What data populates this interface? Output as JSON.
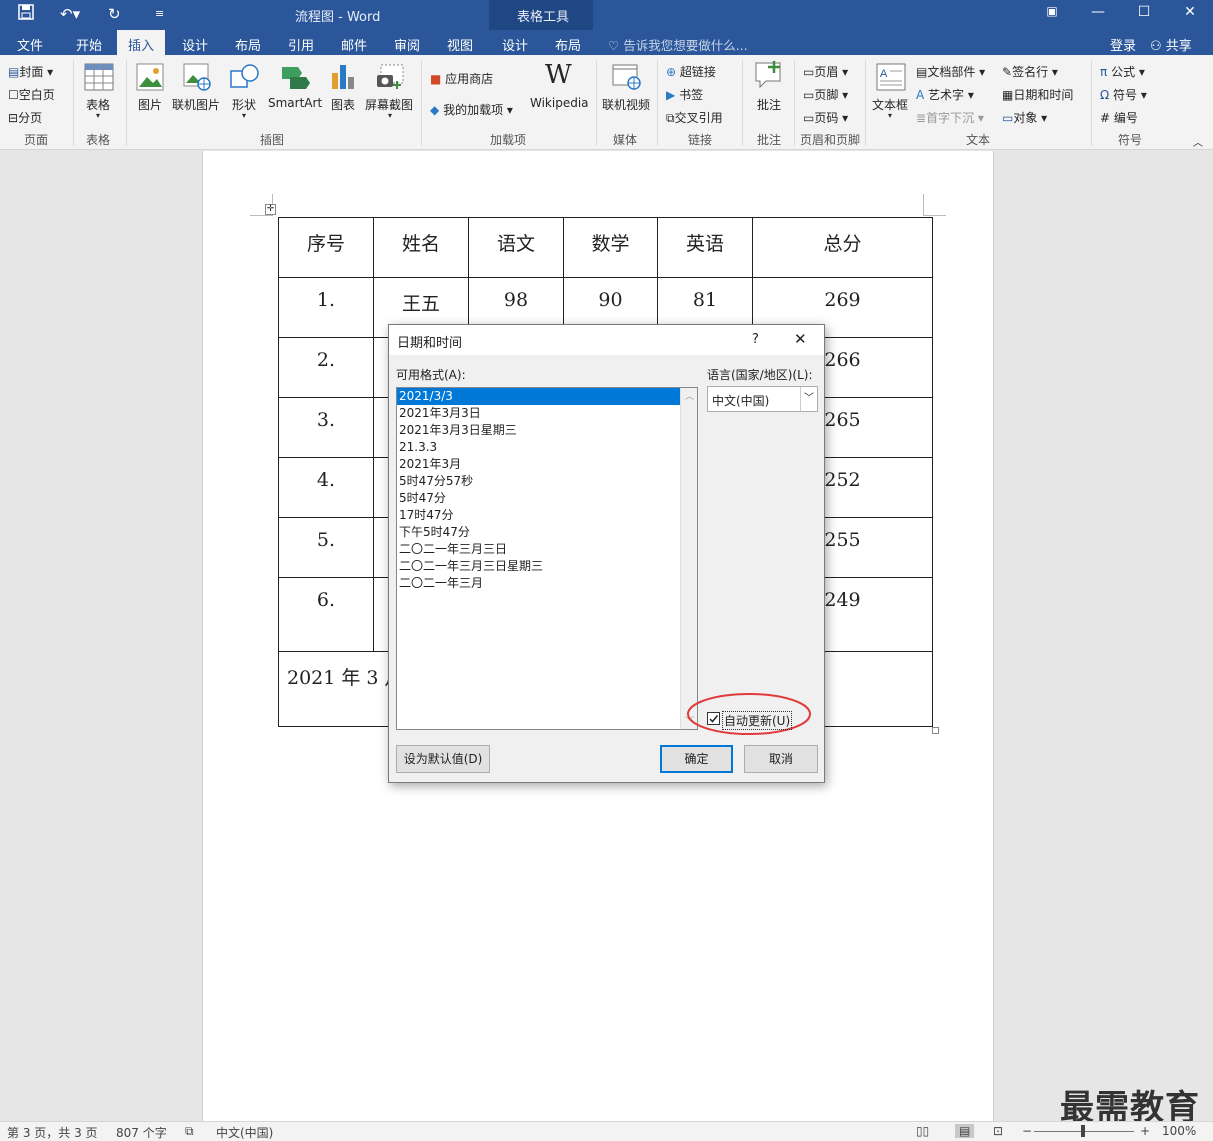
{
  "titlebar": {
    "doc_title": "流程图 - Word",
    "context_title": "表格工具"
  },
  "tabs": [
    "文件",
    "开始",
    "插入",
    "设计",
    "布局",
    "引用",
    "邮件",
    "审阅",
    "视图",
    "设计",
    "布局"
  ],
  "tell_me": "告诉我您想要做什么...",
  "account": {
    "login": "登录",
    "share": "共享"
  },
  "ribbon": {
    "pages": {
      "cover": "封面",
      "blank": "空白页",
      "break": "分页",
      "group": "页面"
    },
    "tables": {
      "table": "表格",
      "group": "表格"
    },
    "illustrations": {
      "picture": "图片",
      "online_picture": "联机图片",
      "shapes": "形状",
      "smartart": "SmartArt",
      "chart": "图表",
      "screenshot": "屏幕截图",
      "group": "插图"
    },
    "addins": {
      "store": "应用商店",
      "my_addins": "我的加载项",
      "wikipedia": "Wikipedia",
      "group": "加载项"
    },
    "media": {
      "online_video": "联机视频",
      "group": "媒体"
    },
    "links": {
      "hyperlink": "超链接",
      "bookmark": "书签",
      "crossref": "交叉引用",
      "group": "链接"
    },
    "comments": {
      "comment": "批注",
      "group": "批注"
    },
    "header_footer": {
      "header": "页眉",
      "footer": "页脚",
      "page_number": "页码",
      "group": "页眉和页脚"
    },
    "text": {
      "textbox": "文本框",
      "quickparts": "文档部件",
      "wordart": "艺术字",
      "dropcap": "首字下沉",
      "signature": "签名行",
      "datetime": "日期和时间",
      "object": "对象",
      "group": "文本"
    },
    "symbols": {
      "equation": "公式",
      "symbol": "符号",
      "number": "编号",
      "group": "符号"
    }
  },
  "table": {
    "headers": [
      "序号",
      "姓名",
      "语文",
      "数学",
      "英语",
      "总分"
    ],
    "rows": [
      [
        "1.",
        "王五",
        "98",
        "90",
        "81",
        "269"
      ],
      [
        "2.",
        "",
        "",
        "",
        "",
        "266"
      ],
      [
        "3.",
        "",
        "",
        "",
        "",
        "265"
      ],
      [
        "4.",
        "",
        "",
        "",
        "",
        "252"
      ],
      [
        "5.",
        "",
        "",
        "",
        "",
        "255"
      ],
      [
        "6.",
        "",
        "",
        "",
        "",
        "249"
      ]
    ],
    "footer_text": "2021 年 3 月"
  },
  "dialog": {
    "title": "日期和时间",
    "help": "?",
    "formats_label": "可用格式(A):",
    "formats": [
      "2021/3/3",
      "2021年3月3日",
      "2021年3月3日星期三",
      "21.3.3",
      "2021年3月",
      "5时47分57秒",
      "5时47分",
      "17时47分",
      "下午5时47分",
      "二〇二一年三月三日",
      "二〇二一年三月三日星期三",
      "二〇二一年三月"
    ],
    "selected_index": 0,
    "language_label": "语言(国家/地区)(L):",
    "language_value": "中文(中国)",
    "auto_update_label": "自动更新(U)",
    "auto_update_checked": true,
    "set_default": "设为默认值(D)",
    "ok": "确定",
    "cancel": "取消",
    "highlight_color": "#e03a3a"
  },
  "status": {
    "page": "第 3 页，共 3 页",
    "words": "807 个字",
    "language": "中文(中国)",
    "zoom": "100%"
  },
  "watermark": "最需教育",
  "colors": {
    "brand": "#2b579a",
    "selection": "#0078d7"
  }
}
